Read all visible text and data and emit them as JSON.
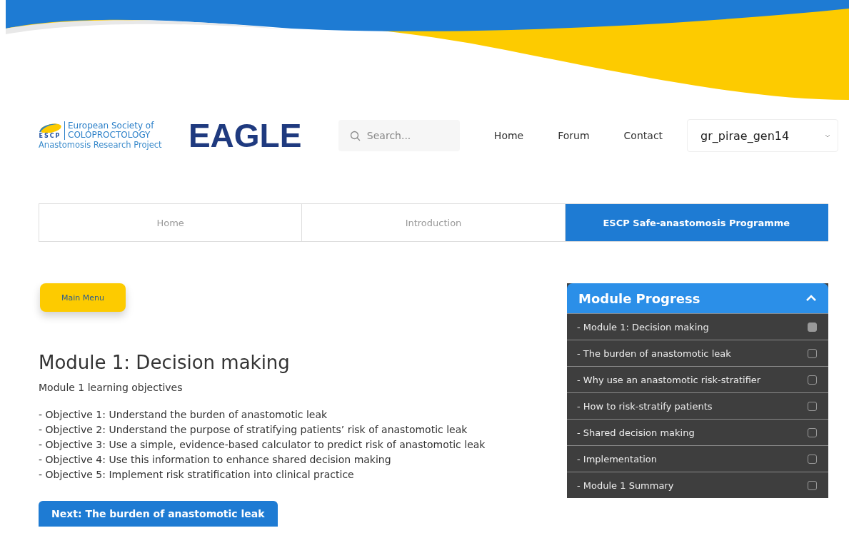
{
  "header": {
    "logo": {
      "mark": "ESCP",
      "line_1": "European Society of",
      "line_2": "COLOPROCTOLOGY",
      "line_3": "Anastomosis Research Project"
    },
    "brand": "EAGLE",
    "search": {
      "placeholder": "Search..."
    },
    "nav": [
      "Home",
      "Forum",
      "Contact"
    ],
    "user": "gr_pirae_gen14"
  },
  "tabs": [
    {
      "label": "Home",
      "selected": false
    },
    {
      "label": "Introduction",
      "selected": false
    },
    {
      "label": "ESCP Safe-anastomosis Programme",
      "selected": true
    }
  ],
  "main_menu_button": "Main Menu",
  "module": {
    "title": "Module 1: Decision making",
    "subtitle": "Module 1 learning objectives",
    "objectives": [
      "- Objective 1: Understand the burden of anastomotic leak",
      "- Objective 2: Understand the purpose of stratifying patients’ risk of anastomotic leak",
      "- Objective 3: Use a simple, evidence-based calculator to predict risk of anastomotic leak",
      "- Objective 4: Use this information to enhance shared decision making",
      "- Objective 5: Implement risk stratification into clinical practice"
    ],
    "next_button": "Next: The burden of anastomotic leak"
  },
  "progress": {
    "title": "Module Progress",
    "expanded": true,
    "items": [
      {
        "label": "- Module 1: Decision making",
        "checked": true
      },
      {
        "label": "- The burden of anastomotic leak",
        "checked": false
      },
      {
        "label": "- Why use an anastomotic risk-stratifier",
        "checked": false
      },
      {
        "label": "- How to risk-stratify patients",
        "checked": false
      },
      {
        "label": "- Shared decision making",
        "checked": false
      },
      {
        "label": "- Implementation",
        "checked": false
      },
      {
        "label": "- Module 1 Summary",
        "checked": false
      }
    ]
  }
}
